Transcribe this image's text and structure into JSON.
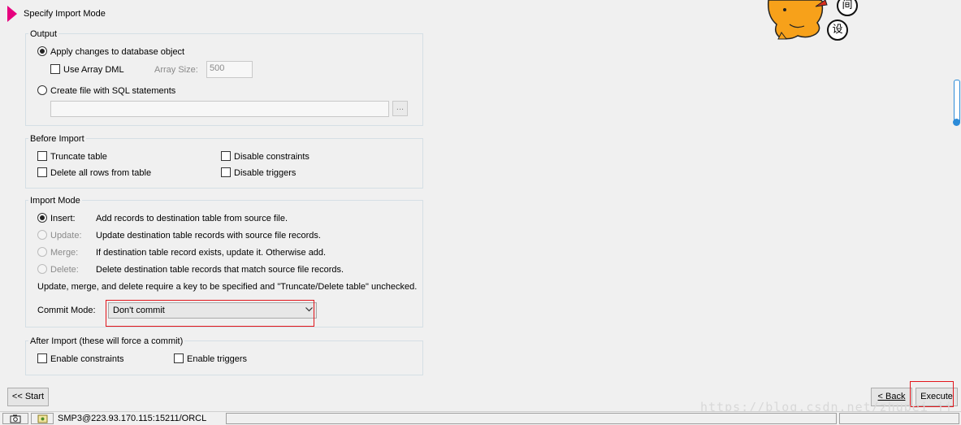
{
  "header": {
    "title": "Specify Import Mode"
  },
  "output": {
    "legend": "Output",
    "apply_label": "Apply changes to database object",
    "array_dml_label": "Use Array DML",
    "array_size_label": "Array Size:",
    "array_size_value": "500",
    "create_file_label": "Create file with SQL statements",
    "file_path_value": "",
    "browse_label": "..."
  },
  "before_import": {
    "legend": "Before Import",
    "truncate_label": "Truncate table",
    "delete_rows_label": "Delete all rows from table",
    "disable_constraints_label": "Disable constraints",
    "disable_triggers_label": "Disable triggers"
  },
  "import_mode": {
    "legend": "Import Mode",
    "modes": [
      {
        "label": "Insert:",
        "desc": "Add records to destination table from source file."
      },
      {
        "label": "Update:",
        "desc": "Update destination table records with source file records."
      },
      {
        "label": "Merge:",
        "desc": "If destination table record exists, update it.  Otherwise add."
      },
      {
        "label": "Delete:",
        "desc": "Delete destination table records that match source file records."
      }
    ],
    "note": "Update, merge, and delete require a key to be specified and \"Truncate/Delete table\" unchecked.",
    "commit_label": "Commit Mode:",
    "commit_value": "Don't commit"
  },
  "after_import": {
    "legend": "After Import (these will force a commit)",
    "enable_constraints_label": "Enable constraints",
    "enable_triggers_label": "Enable triggers"
  },
  "buttons": {
    "start": "<< Start",
    "back": "< Back",
    "execute": "Execute"
  },
  "status": {
    "connection": "SMP3@223.93.170.115:15211/ORCL"
  },
  "overlay": {
    "char1": "间",
    "char2": "设",
    "watermark": "https://blog.csdn.net/zhupei_jj"
  },
  "colors": {
    "accent_arrow": "#e6007e",
    "highlight_box": "#e2151b"
  }
}
